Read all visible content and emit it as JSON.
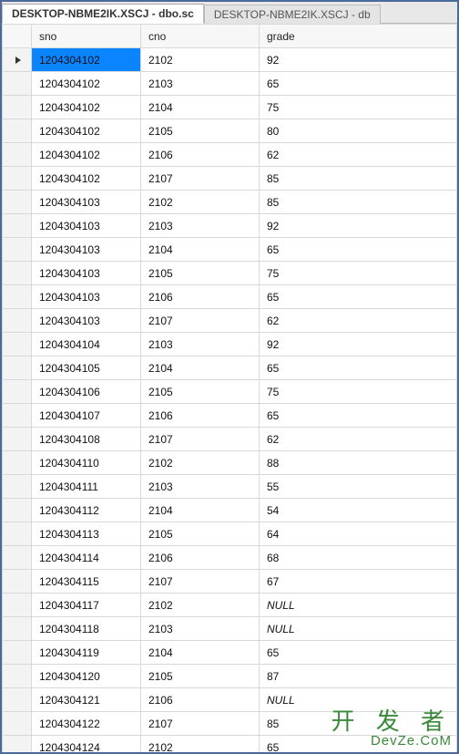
{
  "tabs": [
    {
      "label": "DESKTOP-NBME2IK.XSCJ - dbo.sc",
      "active": true
    },
    {
      "label": "DESKTOP-NBME2IK.XSCJ - db",
      "active": false
    }
  ],
  "columns": [
    "sno",
    "cno",
    "grade"
  ],
  "selected_row_index": 0,
  "selected_col_index": 0,
  "rows": [
    {
      "sno": "1204304102",
      "cno": "2102",
      "grade": "92"
    },
    {
      "sno": "1204304102",
      "cno": "2103",
      "grade": "65"
    },
    {
      "sno": "1204304102",
      "cno": "2104",
      "grade": "75"
    },
    {
      "sno": "1204304102",
      "cno": "2105",
      "grade": "80"
    },
    {
      "sno": "1204304102",
      "cno": "2106",
      "grade": "62"
    },
    {
      "sno": "1204304102",
      "cno": "2107",
      "grade": "85"
    },
    {
      "sno": "1204304103",
      "cno": "2102",
      "grade": "85"
    },
    {
      "sno": "1204304103",
      "cno": "2103",
      "grade": "92"
    },
    {
      "sno": "1204304103",
      "cno": "2104",
      "grade": "65"
    },
    {
      "sno": "1204304103",
      "cno": "2105",
      "grade": "75"
    },
    {
      "sno": "1204304103",
      "cno": "2106",
      "grade": "65"
    },
    {
      "sno": "1204304103",
      "cno": "2107",
      "grade": "62"
    },
    {
      "sno": "1204304104",
      "cno": "2103",
      "grade": "92"
    },
    {
      "sno": "1204304105",
      "cno": "2104",
      "grade": "65"
    },
    {
      "sno": "1204304106",
      "cno": "2105",
      "grade": "75"
    },
    {
      "sno": "1204304107",
      "cno": "2106",
      "grade": "65"
    },
    {
      "sno": "1204304108",
      "cno": "2107",
      "grade": "62"
    },
    {
      "sno": "1204304110",
      "cno": "2102",
      "grade": "88"
    },
    {
      "sno": "1204304111",
      "cno": "2103",
      "grade": "55"
    },
    {
      "sno": "1204304112",
      "cno": "2104",
      "grade": "54"
    },
    {
      "sno": "1204304113",
      "cno": "2105",
      "grade": "64"
    },
    {
      "sno": "1204304114",
      "cno": "2106",
      "grade": "68"
    },
    {
      "sno": "1204304115",
      "cno": "2107",
      "grade": "67"
    },
    {
      "sno": "1204304117",
      "cno": "2102",
      "grade": "NULL"
    },
    {
      "sno": "1204304118",
      "cno": "2103",
      "grade": "NULL"
    },
    {
      "sno": "1204304119",
      "cno": "2104",
      "grade": "65"
    },
    {
      "sno": "1204304120",
      "cno": "2105",
      "grade": "87"
    },
    {
      "sno": "1204304121",
      "cno": "2106",
      "grade": "NULL"
    },
    {
      "sno": "1204304122",
      "cno": "2107",
      "grade": "85"
    },
    {
      "sno": "1204304124",
      "cno": "2102",
      "grade": "65"
    }
  ],
  "watermark": {
    "cn": "开 发 者",
    "en": "DevZe.CoM"
  }
}
